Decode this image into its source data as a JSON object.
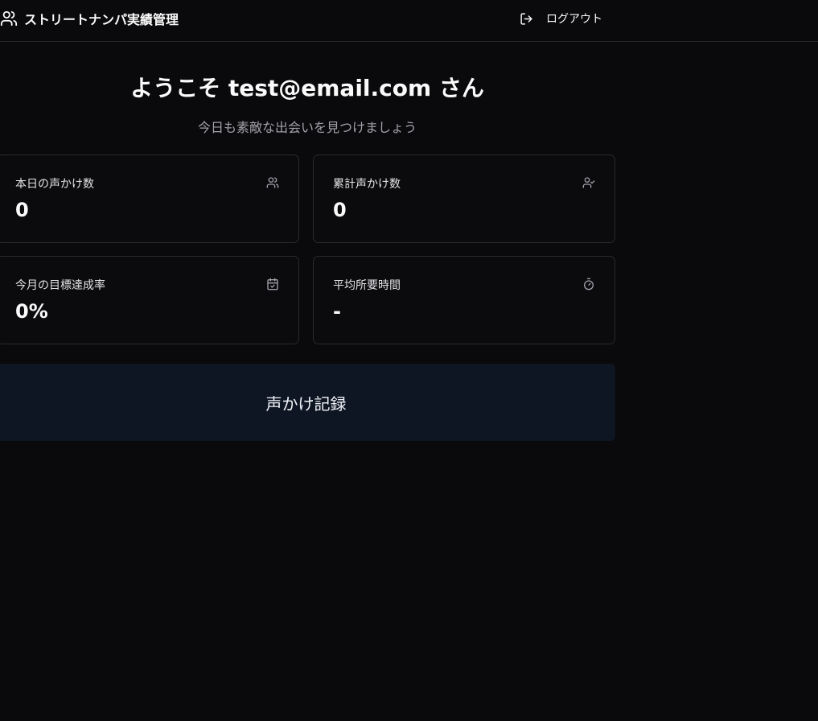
{
  "header": {
    "app_title": "ストリートナンパ実績管理",
    "brand_icon": "users-icon",
    "logout_label": "ログアウト",
    "logout_icon": "log-out-icon"
  },
  "welcome": {
    "title": "ようこそ test@email.com さん",
    "subtitle": "今日も素敵な出会いを見つけましょう"
  },
  "stats": [
    {
      "label": "本日の声かけ数",
      "value": "0",
      "icon": "users-icon"
    },
    {
      "label": "累計声かけ数",
      "value": "0",
      "icon": "user-check-icon"
    },
    {
      "label": "今月の目標達成率",
      "value": "0%",
      "icon": "calendar-check-icon"
    },
    {
      "label": "平均所要時間",
      "value": "-",
      "icon": "timer-icon"
    }
  ],
  "record_button": {
    "label": "声かけ記録"
  },
  "colors": {
    "background": "#0a0a0c",
    "card_border": "#2a2a2e",
    "button_bg": "#0f1623",
    "muted_text": "#a1a1aa"
  }
}
